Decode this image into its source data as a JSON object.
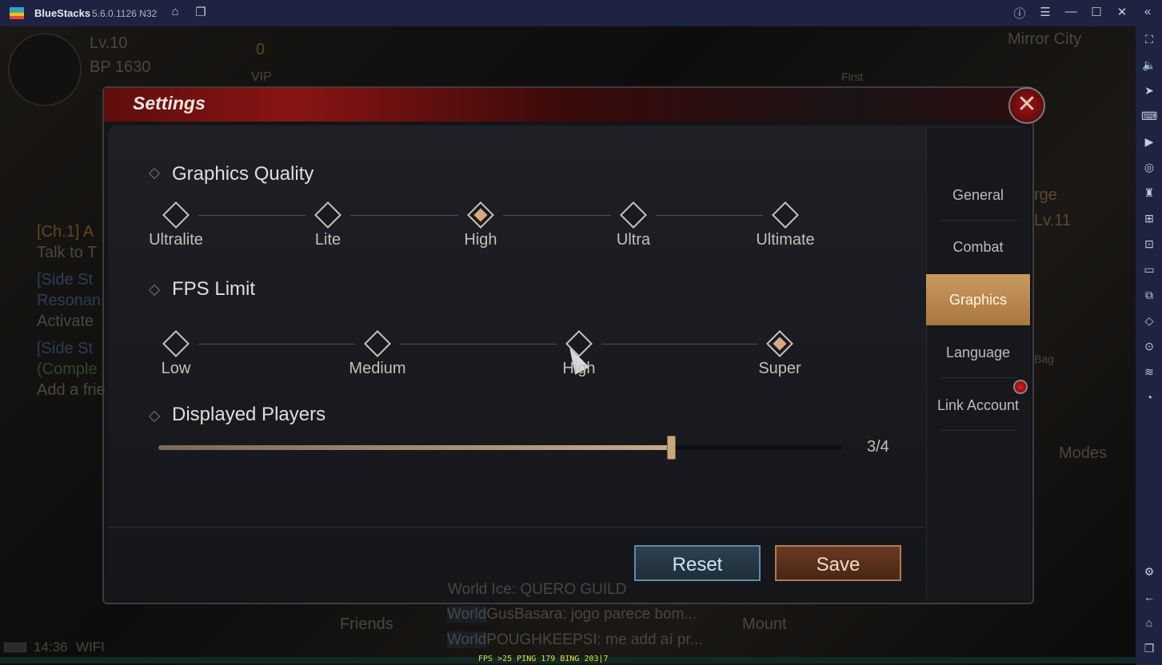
{
  "titlebar": {
    "app": "BlueStacks",
    "version": "5.6.0.1126 N32",
    "icons": [
      "home-icon",
      "multi-instance-icon",
      "help-icon",
      "menu-icon",
      "minimize-icon",
      "maximize-icon",
      "close-icon",
      "collapse-icon"
    ]
  },
  "sidebar_icons": [
    "fullscreen-icon",
    "volume-icon",
    "pointer-icon",
    "keyboard-icon",
    "macro-icon",
    "rotate-icon",
    "gamepad-icon",
    "apk-icon",
    "screenshot-icon",
    "folder-icon",
    "multi-resize-icon",
    "eraser-icon",
    "location-icon",
    "layers-icon",
    "performance-icon",
    "settings-icon",
    "back-icon",
    "home-icon",
    "recent-apps-icon"
  ],
  "game_bg": {
    "level": "Lv.10",
    "bp": "BP  1630",
    "vip": "0",
    "vip_label": "VIP",
    "first": "First",
    "location": "Mirror City",
    "forge": "rge",
    "forge_lv": "Lv.11",
    "bag": "Bag",
    "modes": "Modes",
    "friends": "Friends",
    "mount": "Mount",
    "quests": [
      "[Ch.1] A",
      "Talk to T",
      "[Side St",
      "Resonan",
      "Activate",
      "[Side St",
      "(Comple",
      "Add a frie"
    ],
    "chat": [
      {
        "channel": "World",
        "text": "GusBasara: jogo parece bom..."
      },
      {
        "channel": "World",
        "text": "POUGHKEEPSI: me add aí pr..."
      }
    ],
    "chat_faded": "World Ice: QUERO GUILD",
    "time": "14:36",
    "network": "WIFI"
  },
  "fps_overlay": "FPS >25 PING 179 BING 203|7",
  "settings": {
    "title": "Settings",
    "tabs": [
      {
        "label": "General"
      },
      {
        "label": "Combat"
      },
      {
        "label": "Graphics",
        "selected": true
      },
      {
        "label": "Language"
      },
      {
        "label": "Link Account",
        "notification": true
      }
    ],
    "graphics_quality": {
      "label": "Graphics Quality",
      "options": [
        "Ultralite",
        "Lite",
        "High",
        "Ultra",
        "Ultimate"
      ],
      "selected": "High"
    },
    "fps_limit": {
      "label": "FPS Limit",
      "options": [
        "Low",
        "Medium",
        "High",
        "Super"
      ],
      "selected": "Super"
    },
    "displayed_players": {
      "label": "Displayed Players",
      "value": 3,
      "max": 4,
      "display": "3/4"
    },
    "reset": "Reset",
    "save": "Save"
  },
  "colors": {
    "accent_gold": "#c99a5e",
    "header_red": "#8a1414",
    "reset_blue": "#5f8aa6",
    "save_copper": "#b27a50"
  }
}
